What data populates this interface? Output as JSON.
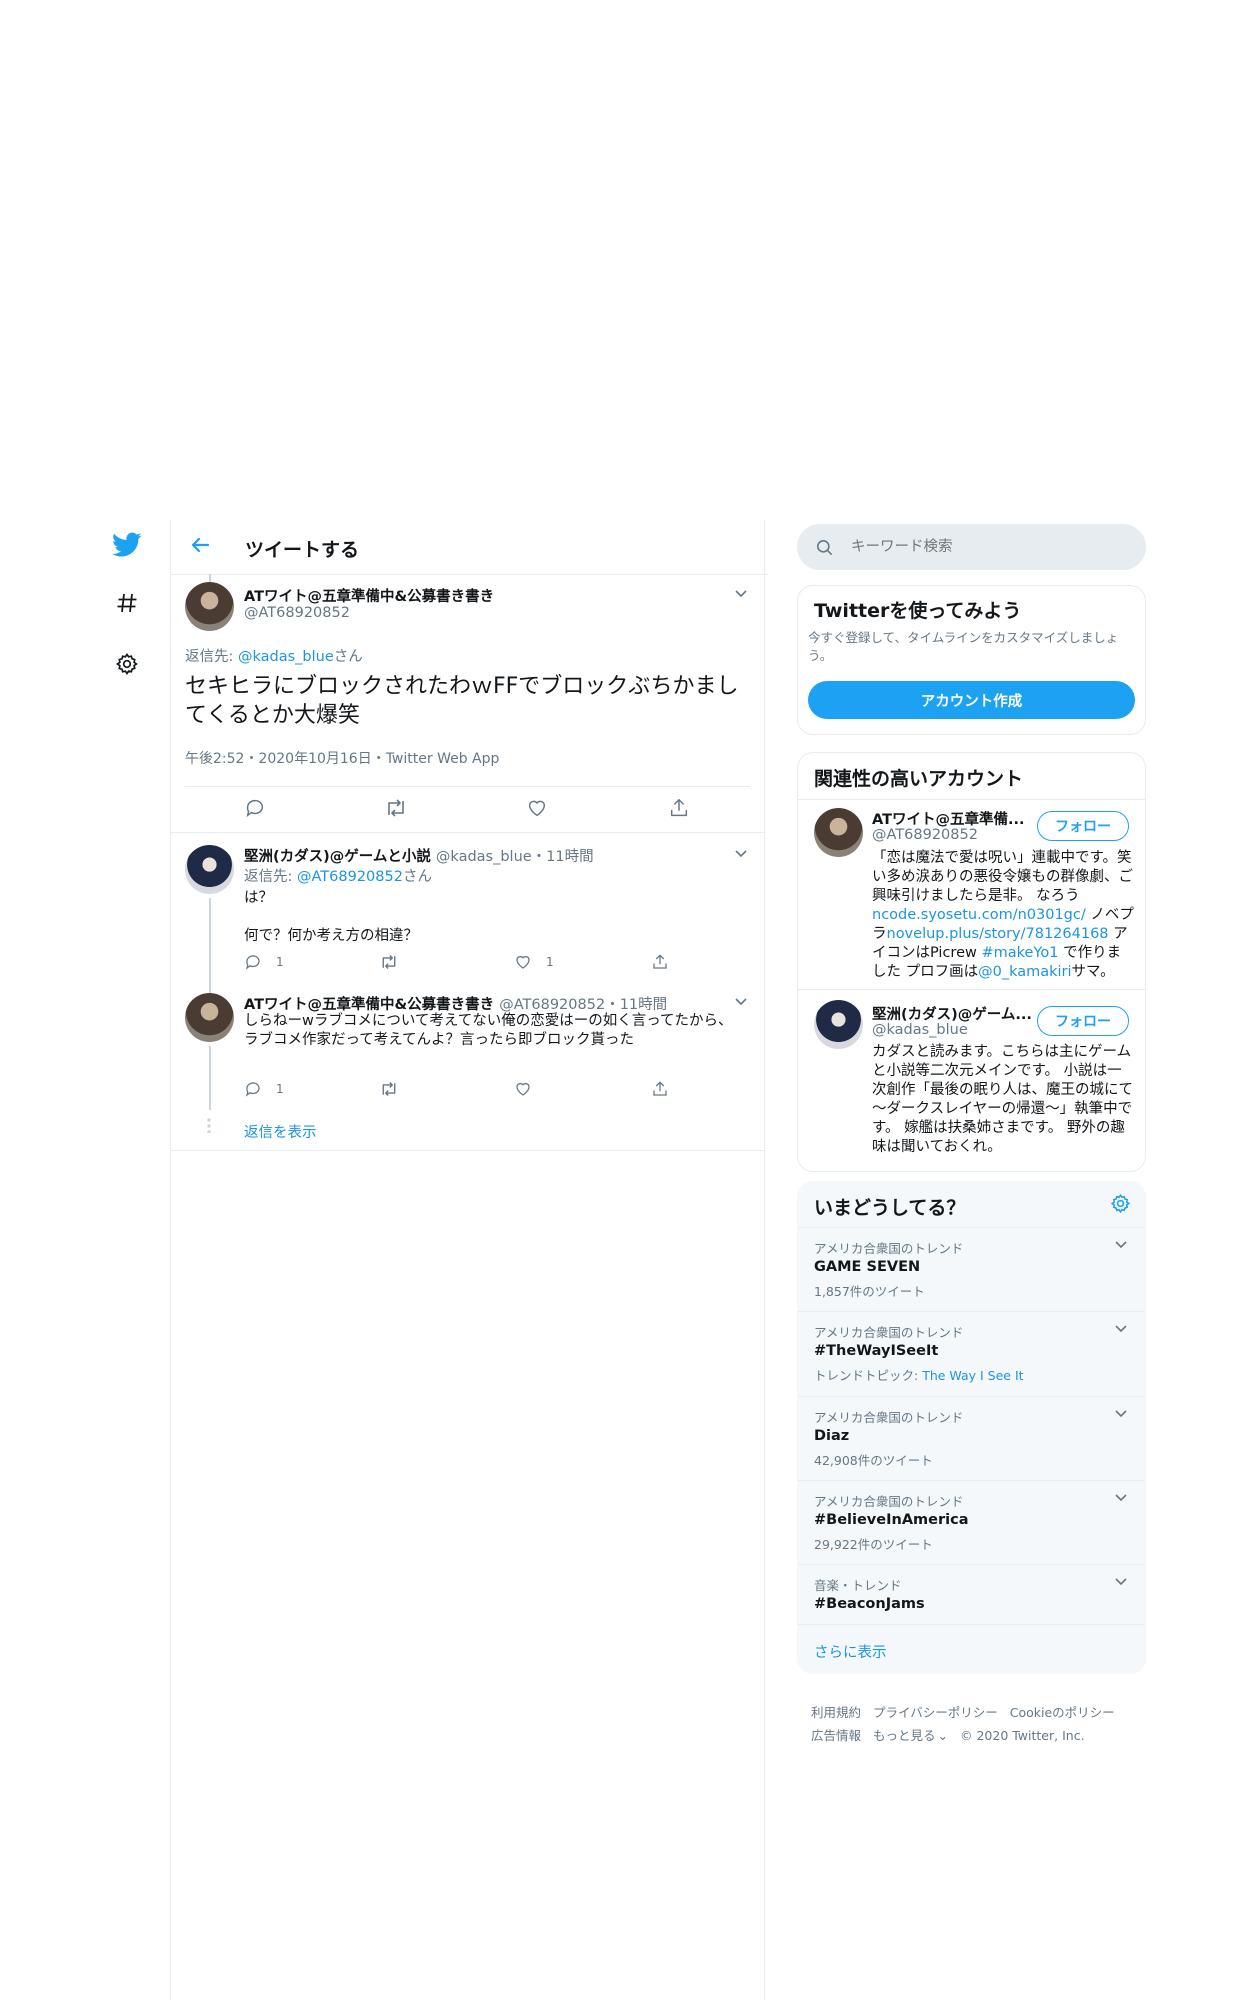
{
  "header": {
    "title": "ツイートする"
  },
  "main_tweet": {
    "name": "ATワイト@五章準備中&公募書き書き",
    "handle": "@AT68920852",
    "reply_prefix": "返信先: ",
    "reply_to": "@kadas_blue",
    "reply_suffix": "さん",
    "text": "セキヒラにブロックされたわｗFFでブロックぶちかましてくるとか大爆笑",
    "meta": "午後2:52・2020年10月16日・Twitter Web App"
  },
  "replies": [
    {
      "name": "堅洲(カダス)@ゲームと小説",
      "handle": "@kadas_blue",
      "time": "・11時間",
      "reply_prefix": "返信先: ",
      "reply_to": "@AT68920852",
      "reply_suffix": "さん",
      "line1": "は？",
      "line2": "何で？何か考え方の相違？",
      "reply_count": "1",
      "like_count": "1"
    },
    {
      "name": "ATワイト@五章準備中&公募書き書き",
      "handle": "@AT68920852",
      "time": "・11時間",
      "text": "しらねーwラブコメについて考えてない俺の恋愛はーの如く言ってたから、ラブコメ作家だって考えてんよ？言ったら即ブロック貰った",
      "reply_count": "1",
      "show_replies": "返信を表示"
    }
  ],
  "search": {
    "placeholder": "キーワード検索"
  },
  "signup": {
    "title": "Twitterを使ってみよう",
    "desc": "今すぐ登録して、タイムラインをカスタマイズしましょう。",
    "button": "アカウント作成"
  },
  "related": {
    "title": "関連性の高いアカウント",
    "follow_label": "フォロー",
    "accounts": [
      {
        "name": "ATワイト@五章準備...",
        "handle": "@AT68920852",
        "bio_a": "「恋は魔法で愛は呪い」連載中です。笑い多め涙ありの悪役令嬢もの群像劇、ご興味引けましたら是非。 なろう",
        "bio_link1": "ncode.syosetu.com/n0301gc/",
        "bio_b": " ノベプラ",
        "bio_link2": "novelup.plus/story/781264168",
        "bio_c": " アイコンはPicrew ",
        "bio_link3": "#makeYo1",
        "bio_d": " で作りました プロフ画は",
        "bio_link4": "@0_kamakiri",
        "bio_e": "サマ。"
      },
      {
        "name": "堅洲(カダス)@ゲーム...",
        "handle": "@kadas_blue",
        "bio": "カダスと読みます。こちらは主にゲームと小説等二次元メインです。 小説は一次創作「最後の眠り人は、魔王の城にて～ダークスレイヤーの帰還～」執筆中です。 嫁艦は扶桑姉さまです。 野外の趣味は聞いておくれ。"
      }
    ]
  },
  "trends": {
    "title": "いまどうしてる？",
    "items": [
      {
        "category": "アメリカ合衆国のトレンド",
        "name": "GAME SEVEN",
        "meta": "1,857件のツイート"
      },
      {
        "category": "アメリカ合衆国のトレンド",
        "name": "#TheWayISeeIt",
        "meta_prefix": "トレンドトピック: ",
        "meta_link": "The Way I See It"
      },
      {
        "category": "アメリカ合衆国のトレンド",
        "name": "Diaz",
        "meta": "42,908件のツイート"
      },
      {
        "category": "アメリカ合衆国のトレンド",
        "name": "#BelieveInAmerica",
        "meta": "29,922件のツイート"
      },
      {
        "category": "音楽・トレンド",
        "name": "#BeaconJams"
      }
    ],
    "show_more": "さらに表示"
  },
  "footer": {
    "terms": "利用規約",
    "privacy": "プライバシーポリシー",
    "cookie": "Cookieのポリシー",
    "ads": "広告情報",
    "more": "もっと見る",
    "copyright": "© 2020 Twitter, Inc."
  },
  "colors": {
    "accent": "#1da1f2",
    "link": "#1b95e0",
    "muted": "#657786",
    "border": "#e6ecf0"
  }
}
